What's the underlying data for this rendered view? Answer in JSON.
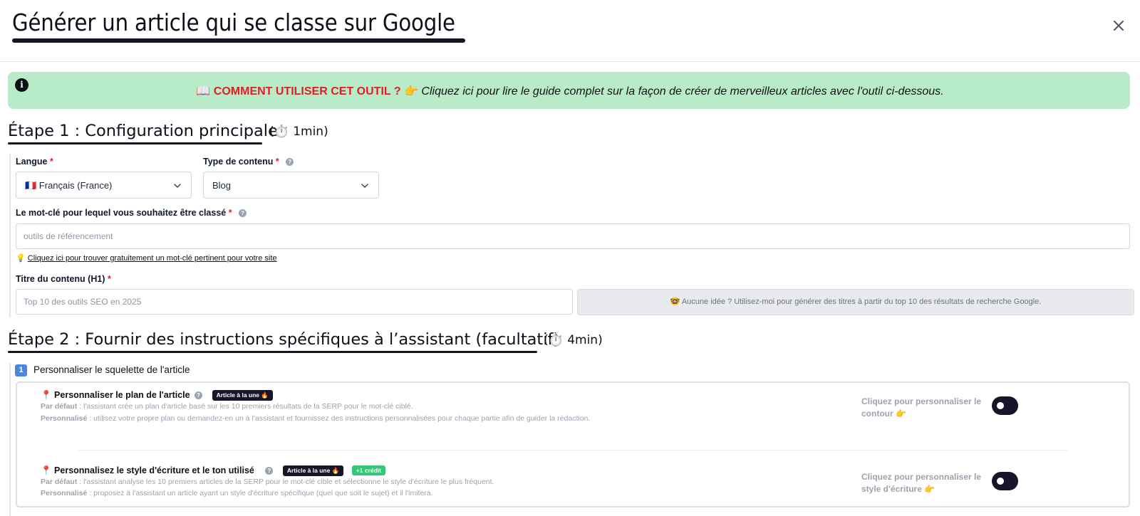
{
  "header": {
    "title": "Générer un article qui se classe sur Google",
    "close_icon": "close-icon"
  },
  "banner": {
    "icon": "info-icon",
    "emoji": "📖",
    "strong_text": "COMMENT UTILISER CET OUTIL ?",
    "pointer_emoji": "👉",
    "link_text": "Cliquez ici pour lire le guide complet sur la façon de créer de merveilleux articles avec l'outil ci-dessous.",
    "bg_color": "#b8ecc8",
    "accent_color": "#e11d26"
  },
  "step1": {
    "heading": "Étape 1 : Configuration principale",
    "time": "(⏱️ 1min)",
    "langue": {
      "label": "Langue",
      "required": "*",
      "value": "🇫🇷 Français (France)"
    },
    "type_contenu": {
      "label": "Type de contenu",
      "required": "*",
      "value": "Blog"
    },
    "keyword": {
      "label": "Le mot-clé pour lequel vous souhaitez être classé",
      "required": "*",
      "placeholder": "outils de référencement",
      "tip_icon": "💡",
      "tip_link": "Cliquez ici pour trouver gratuitement un mot-clé pertinent pour votre site"
    },
    "h1": {
      "label": "Titre du contenu (H1)",
      "required": "*",
      "placeholder": "Top 10 des outils SEO en 2025",
      "generate_button": "🤓 Aucune idée ? Utilisez-moi pour générer des titres à partir du top 10 des résultats de recherche Google."
    }
  },
  "step2": {
    "heading": "Étape 2 : Fournir des instructions spécifiques à l’assistant (facultatif)",
    "time": "(⏱️ 4min)",
    "section": {
      "number": "1",
      "title": "Personnaliser le squelette de l'article"
    },
    "options": [
      {
        "title": "📍 Personnaliser le plan de l'article",
        "badge": "Article à la une 🔥",
        "default_label": "Par défaut",
        "default_text": " : l'assistant crée un plan d'article basé sur les 10 premiers résultats de la SERP pour le mot-clé ciblé.",
        "custom_label": "Personnalisé",
        "custom_text": " : utilisez votre propre plan ou demandez-en un à l'assistant et fournissez des instructions personnalisées pour chaque partie afin de guider la rédaction.",
        "cta": "Cliquez pour personnaliser le contour 👉",
        "toggle_on": false
      },
      {
        "title": "📍 Personnalisez le style d'écriture et le ton utilisé",
        "badge": "Article à la une 🔥",
        "credit_badge": "+1 crédit",
        "default_label": "Par défaut",
        "default_text": " : l'assistant analyse les 10 premiers articles de la SERP pour le mot-clé cible et sélectionne le style d'écriture le plus fréquent.",
        "custom_label": "Personnalisé",
        "custom_text": " : proposez à l'assistant un article ayant un style d'écriture spécifique (quel que soit le sujet) et il l'imitera.",
        "cta": "Cliquez pour personnaliser le style d'écriture 👉",
        "toggle_on": false
      }
    ]
  }
}
